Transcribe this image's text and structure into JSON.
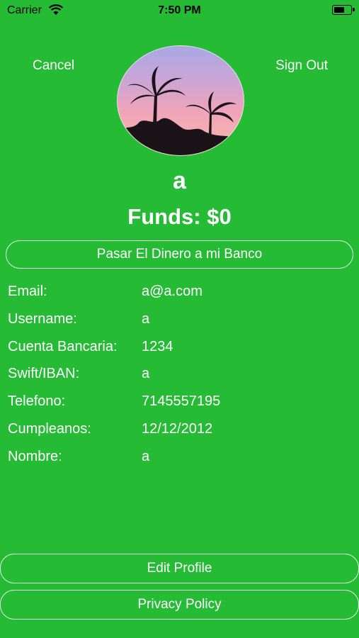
{
  "status_bar": {
    "carrier": "Carrier",
    "time": "7:50 PM",
    "icons": [
      "wifi-icon",
      "battery-icon"
    ]
  },
  "header": {
    "cancel_label": "Cancel",
    "sign_out_label": "Sign Out"
  },
  "profile": {
    "name": "a",
    "funds": "Funds: $0",
    "avatar": "palm-trees-sunset-photo"
  },
  "bank_button_label": "Pasar El Dinero a mi Banco",
  "details": [
    {
      "label": "Email:",
      "value": "a@a.com"
    },
    {
      "label": "Username:",
      "value": "a"
    },
    {
      "label": "Cuenta Bancaria:",
      "value": "1234"
    },
    {
      "label": "Swift/IBAN:",
      "value": "a"
    },
    {
      "label": "Telefono:",
      "value": "7145557195"
    },
    {
      "label": "Cumpleanos:",
      "value": "12/12/2012"
    },
    {
      "label": "Nombre:",
      "value": "a"
    }
  ],
  "footer": {
    "edit_profile_label": "Edit Profile",
    "privacy_policy_label": "Privacy Policy"
  },
  "colors": {
    "background": "#25bb35",
    "text": "#ffffff"
  }
}
